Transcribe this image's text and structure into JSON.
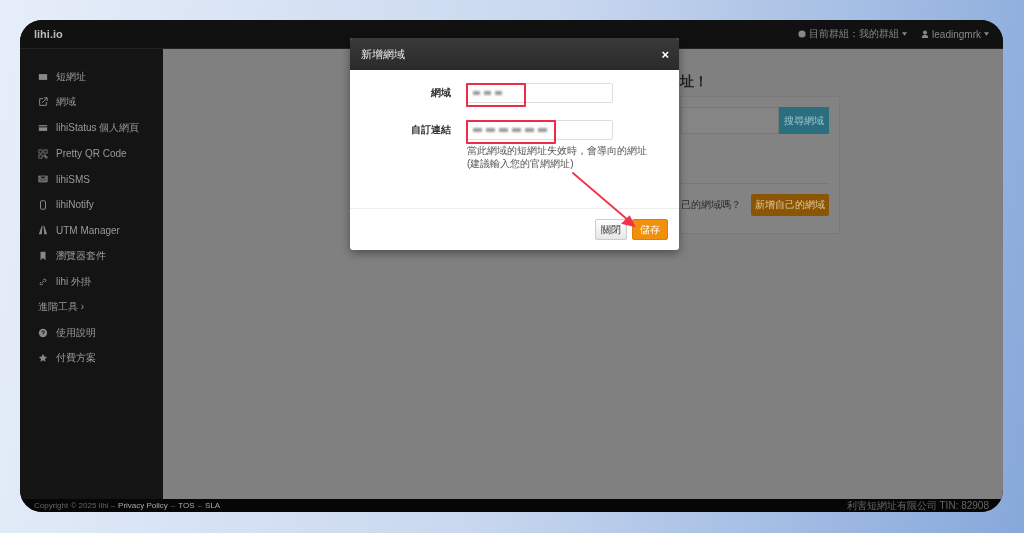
{
  "topbar": {
    "brand": "lihi.io",
    "group_menu": "目前群組：我的群組",
    "user_menu": "leadingmrk"
  },
  "sidebar": {
    "items": [
      {
        "kind": "link",
        "label": "短網址"
      },
      {
        "kind": "link",
        "label": "網域"
      },
      {
        "kind": "link",
        "label": "lihiStatus 個人網頁"
      },
      {
        "kind": "link",
        "label": "Pretty QR Code"
      },
      {
        "kind": "link",
        "label": "lihiSMS"
      },
      {
        "kind": "link",
        "label": "lihiNotify"
      },
      {
        "kind": "link",
        "label": "UTM Manager"
      },
      {
        "kind": "link",
        "label": "瀏覽器套件"
      },
      {
        "kind": "link",
        "label": "lihi 外掛"
      },
      {
        "kind": "section",
        "label": "進階工具 ›"
      },
      {
        "kind": "link",
        "label": "使用說明"
      },
      {
        "kind": "link",
        "label": "付費方案"
      }
    ]
  },
  "background_page": {
    "heading": "址！",
    "search_button": "搜尋網域",
    "question": "已的網域嗎？",
    "add_button": "新增自己的網域"
  },
  "modal": {
    "title": "新增網域",
    "close": "×",
    "fields": [
      {
        "label": "網域",
        "highlighted": true
      },
      {
        "label": "自訂連結",
        "highlighted": true
      }
    ],
    "help": [
      "當此網域的短網址失效時，會導向的網址",
      "(建議輸入您的官網網址)"
    ],
    "buttons": [
      {
        "label": "關閉",
        "kind": "default"
      },
      {
        "label": "儲存",
        "kind": "primary"
      }
    ]
  },
  "footer": {
    "copyright": "Copyright © 2025 lihi –",
    "links": [
      "Privacy Policy",
      "–",
      "TOS",
      "–",
      "SLA"
    ],
    "company": "利害短網址有限公司 TIN: 82908"
  }
}
